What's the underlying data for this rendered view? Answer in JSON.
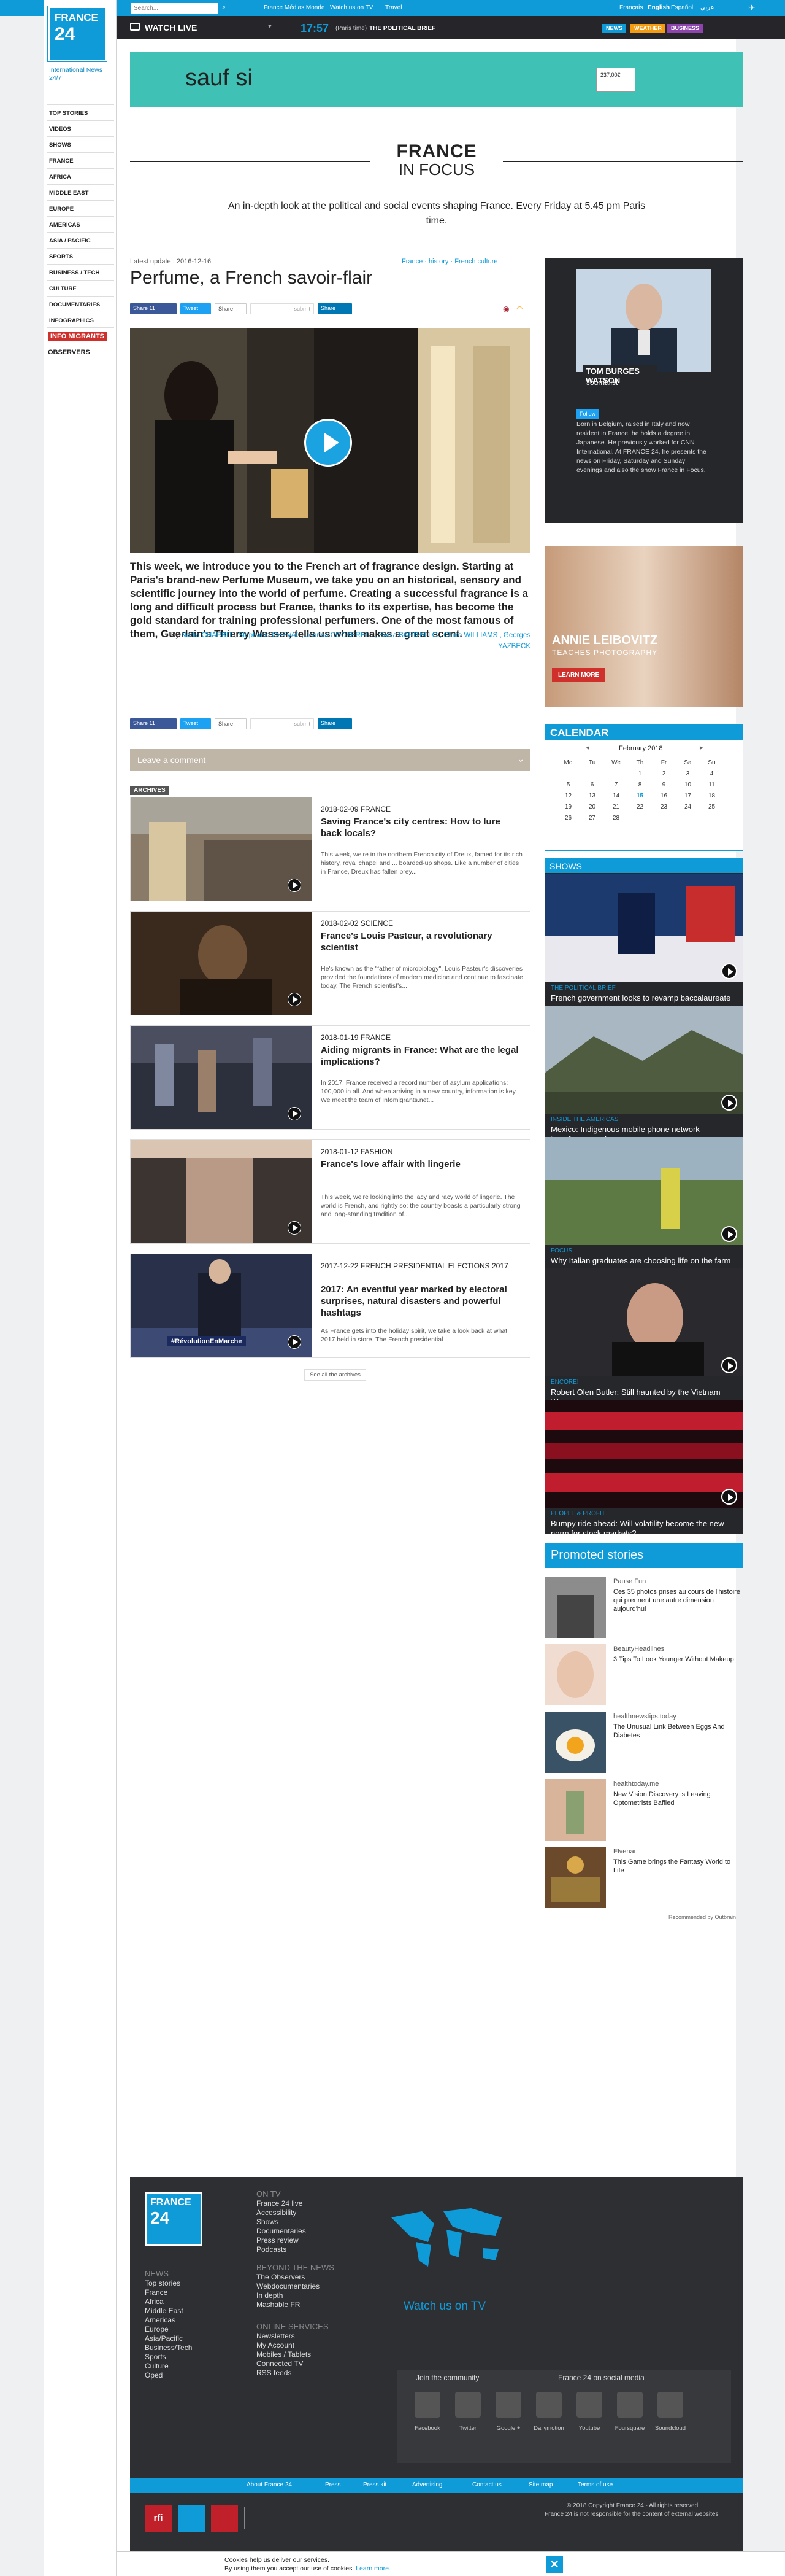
{
  "topbar": {
    "search_placeholder": "Search...",
    "nav": [
      "France Médias Monde",
      "Watch us on TV",
      "Travel"
    ],
    "languages": [
      "Français",
      "English",
      "Español",
      "عربي"
    ]
  },
  "brand": {
    "name_line1": "FRANCE",
    "name_line2": "24",
    "tagline": "International News 24/7",
    "color": "#0f9ad8"
  },
  "sidebar": {
    "items": [
      "TOP STORIES",
      "VIDEOS",
      "SHOWS",
      "FRANCE",
      "AFRICA",
      "MIDDLE EAST",
      "EUROPE",
      "AMERICAS",
      "ASIA / PACIFIC",
      "SPORTS",
      "BUSINESS / TECH",
      "CULTURE",
      "DOCUMENTARIES",
      "INFOGRAPHICS"
    ],
    "badge_info": "INFO MIGRANTS",
    "badge_observers": "OBSERVERS"
  },
  "livebar": {
    "watch_label": "WATCH LIVE",
    "time": "17:57",
    "time_zone": "(Paris time)",
    "program": "THE POLITICAL BRIEF",
    "pills": [
      "NEWS",
      "WEATHER",
      "BUSINESS"
    ]
  },
  "ad": {
    "text": "sauf si",
    "badge": "237,00€"
  },
  "show": {
    "title_line1": "FRANCE",
    "title_line2": "IN FOCUS",
    "description": "An in-depth look at the political and social events shaping France. Every Friday at 5.45 pm Paris time."
  },
  "article": {
    "update_label": "Latest update :",
    "update_date": "2016-12-16",
    "breadcrumbs": [
      "France",
      "history",
      "French culture"
    ],
    "title": "Perfume, a French savoir-flair",
    "lede": "This week, we introduce you to the French art of fragrance design. Starting at Paris's brand-new Perfume Museum, we take you on an historical, sensory and scientific journey into the world of perfume. Creating a successful fragrance is a long and difficult process but France, thanks to its expertise, has become the gold standard for training professional perfumers. One of the most famous of them, Guerlain's Thierry Wasser, tells us what makes a great scent.",
    "by_label": "By",
    "authors": [
      "Nadia CHARBIT",
      "Stéphanie CHEVAL",
      "Joanna COCKERELL",
      "Sonia BARITELLO",
      "Claire WILLIAMS",
      "Georges YAZBECK"
    ],
    "share": {
      "facebook": "Share",
      "facebook_count": "11",
      "twitter": "Tweet",
      "google": "Share",
      "submit": "submit",
      "linkedin": "Share"
    },
    "comment_label": "Leave a comment"
  },
  "archives": {
    "label": "ARCHIVES",
    "items": [
      {
        "meta": "2018-02-09 FRANCE",
        "title": "Saving France's city centres: How to lure back locals?",
        "text": "This week, we're in the northern French city of Dreux, famed for its rich history, royal chapel and ... boarded-up shops. Like a number of cities in France, Dreux has fallen prey..."
      },
      {
        "meta": "2018-02-02 SCIENCE",
        "title": "France's Louis Pasteur, a revolutionary scientist",
        "text": "He's known as the \"father of microbiology\". Louis Pasteur's discoveries provided the foundations of modern medicine and continue to fascinate today. The French scientist's..."
      },
      {
        "meta": "2018-01-19 FRANCE",
        "title": "Aiding migrants in France: What are the legal implications?",
        "text": "In 2017, France received a record number of asylum applications: 100,000 in all. And when arriving in a new country, information is key. We meet the team of Infomigrants.net..."
      },
      {
        "meta": "2018-01-12 FASHION",
        "title": "France's love affair with lingerie",
        "text": "This week, we're looking into the lacy and racy world of lingerie. The world is French, and rightly so: the country boasts a particularly strong and long-standing tradition of..."
      },
      {
        "meta": "2017-12-22 FRENCH PRESIDENTIAL ELECTIONS 2017",
        "title": "2017: An eventful year marked by electoral surprises, natural disasters and powerful hashtags",
        "text": "As France gets into the holiday spirit, we take a look back at what 2017 held in store. The French presidential"
      }
    ],
    "see_all": "See all the archives",
    "hashtag": "#RévolutionEnMarche"
  },
  "journalist": {
    "name": "TOM BURGES WATSON",
    "role": "Journalist",
    "follow": "Follow",
    "bio": "Born in Belgium, raised in Italy and now resident in France, he holds a degree in Japanese. He previously worked for CNN International. At FRANCE 24, he presents the news on Friday, Saturday and Sunday evenings and also the show France in Focus."
  },
  "ad2": {
    "headline": "ANNIE LEIBOVITZ",
    "sub": "TEACHES PHOTOGRAPHY",
    "button": "LEARN MORE"
  },
  "calendar": {
    "title": "CALENDAR",
    "month": "February 2018",
    "prev": "◄",
    "next": "►",
    "days": [
      "Mo",
      "Tu",
      "We",
      "Th",
      "Fr",
      "Sa",
      "Su"
    ],
    "weeks": [
      [
        "",
        "",
        "",
        "1",
        "2",
        "3",
        "4"
      ],
      [
        "5",
        "6",
        "7",
        "8",
        "9",
        "10",
        "11"
      ],
      [
        "12",
        "13",
        "14",
        "15",
        "16",
        "17",
        "18"
      ],
      [
        "19",
        "20",
        "21",
        "22",
        "23",
        "24",
        "25"
      ],
      [
        "26",
        "27",
        "28",
        "",
        "",
        "",
        ""
      ]
    ],
    "highlight": "15"
  },
  "shows": {
    "title": "SHOWS",
    "items": [
      {
        "category": "THE POLITICAL BRIEF",
        "title": "French government looks to revamp baccalaureate exam"
      },
      {
        "category": "INSIDE THE AMERICAS",
        "title": "Mexico: Indigenous mobile phone network transforms rural areas"
      },
      {
        "category": "FOCUS",
        "title": "Why Italian graduates are choosing life on the farm"
      },
      {
        "category": "ENCORE!",
        "title": "Robert Olen Butler: Still haunted by the Vietnam War"
      },
      {
        "category": "PEOPLE & PROFIT",
        "title": "Bumpy ride ahead: Will volatility become the new norm for stock markets?"
      }
    ]
  },
  "promoted": {
    "title": "Promoted stories",
    "items": [
      {
        "source": "Pause Fun",
        "title": "Ces 35 photos prises au cours de l'histoire qui prennent une autre dimension aujourd'hui"
      },
      {
        "source": "BeautyHeadlines",
        "title": "3 Tips To Look Younger Without Makeup"
      },
      {
        "source": "healthnewstips.today",
        "title": "The Unusual Link Between Eggs And Diabetes"
      },
      {
        "source": "healthtoday.me",
        "title": "New Vision Discovery is Leaving Optometrists Baffled"
      },
      {
        "source": "Elvenar",
        "title": "This Game brings the Fantasy World to Life"
      }
    ],
    "recommended": "Recommended by Outbrain"
  },
  "footer": {
    "ontv_title": "ON TV",
    "ontv": [
      "France 24 live",
      "Accessibility",
      "Shows",
      "Documentaries",
      "Press review",
      "Podcasts"
    ],
    "news_title": "NEWS",
    "news": [
      "Top stories",
      "France",
      "Africa",
      "Middle East",
      "Americas",
      "Europe",
      "Asia/Pacific",
      "Business/Tech",
      "Sports",
      "Culture",
      "Oped"
    ],
    "beyond_title": "BEYOND THE NEWS",
    "beyond": [
      "The Observers",
      "Webdocumentaries",
      "In depth",
      "Mashable FR"
    ],
    "online_title": "ONLINE SERVICES",
    "online": [
      "Newsletters",
      "My Account",
      "Mobiles / Tablets",
      "Connected TV",
      "RSS feeds"
    ],
    "watch_tv": "Watch us on TV",
    "join": "Join the community",
    "social_media": "France 24 on social media",
    "socials": [
      "Facebook",
      "Twitter",
      "Google +",
      "Dailymotion",
      "Youtube",
      "Foursquare",
      "Soundcloud"
    ],
    "links": [
      "About France 24",
      "Press",
      "Press kit",
      "Advertising",
      "Contact us",
      "Site map",
      "Terms of use"
    ],
    "copyright": "© 2018 Copyright France 24 - All rights reserved",
    "disclaimer": "France 24 is not responsible for the content of external websites"
  },
  "cookie": {
    "line1": "Cookies help us deliver our services.",
    "line2": "By using them you accept our use of cookies.",
    "learn": "Learn more.",
    "close": "✕"
  }
}
